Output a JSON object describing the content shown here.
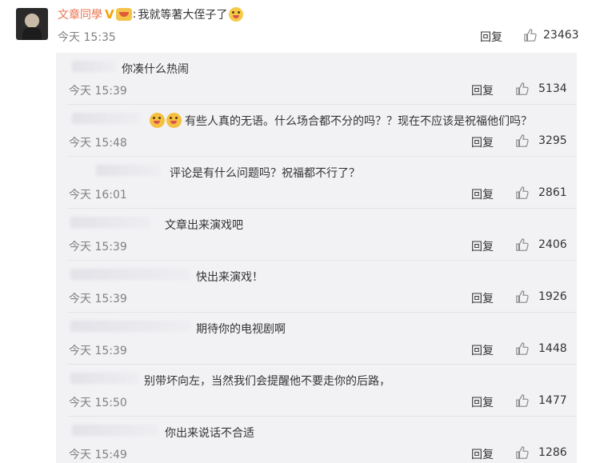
{
  "main_comment": {
    "username": "文章同學",
    "verified_mark": "V",
    "badge_icon": "member-face-icon",
    "colon": ":",
    "text": "我就等著大侄子了",
    "emoji_icon": "smiling-face-icon",
    "time": "今天 15:35",
    "reply_label": "回复",
    "likes": "23463"
  },
  "replies": [
    {
      "text": "你凑什么热闹",
      "time": "今天 15:39",
      "reply_label": "回复",
      "likes": "5134"
    },
    {
      "text": "有些人真的无语。什么场合都不分的吗？？现在不应该是祝福他们吗？",
      "time": "今天 15:48",
      "reply_label": "回复",
      "likes": "3295",
      "emoji_icon": "grinning-sweat-icon"
    },
    {
      "text": "评论是有什么问题吗？祝福都不行了？",
      "time": "今天 16:01",
      "reply_label": "回复",
      "likes": "2861"
    },
    {
      "text": "文章出来演戏吧",
      "time": "今天 15:39",
      "reply_label": "回复",
      "likes": "2406"
    },
    {
      "text": "快出来演戏！",
      "time": "今天 15:39",
      "reply_label": "回复",
      "likes": "1926"
    },
    {
      "text": "期待你的电视剧啊",
      "time": "今天 15:39",
      "reply_label": "回复",
      "likes": "1448"
    },
    {
      "text": "别带坏向左，当然我们会提醒他不要走你的后路，",
      "time": "今天 15:50",
      "reply_label": "回复",
      "likes": "1477"
    },
    {
      "text": "你出来说话不合适",
      "time": "今天 15:49",
      "reply_label": "回复",
      "likes": "1286"
    }
  ],
  "colors": {
    "username": "#eb7350",
    "time": "#808080",
    "sub_background": "#f2f2f5"
  }
}
